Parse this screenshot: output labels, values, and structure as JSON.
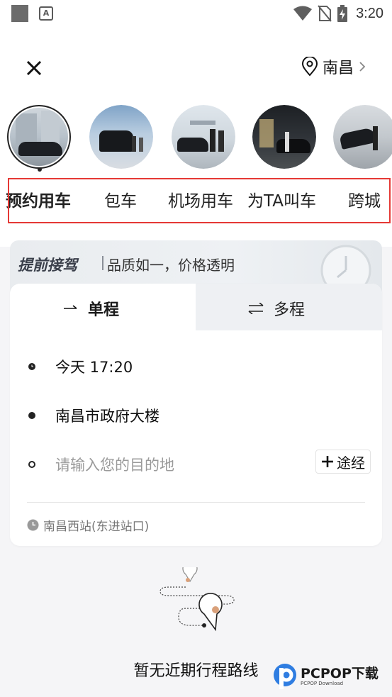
{
  "status_bar": {
    "time": "3:20",
    "icons": [
      "notification-square-icon",
      "a-app-icon",
      "wifi-icon",
      "no-sim-icon",
      "battery-charging-icon"
    ]
  },
  "header": {
    "close_icon": "close-icon",
    "city": "南昌",
    "city_icon": "location-pin-icon",
    "chevron_icon": "chevron-right-icon"
  },
  "services": [
    {
      "label": "预约用车",
      "active": true
    },
    {
      "label": "包车",
      "active": false
    },
    {
      "label": "机场用车",
      "active": false
    },
    {
      "label": "为TA叫车",
      "active": false
    },
    {
      "label": "跨城",
      "active": false
    }
  ],
  "promo": {
    "title": "提前接驾",
    "subtitle": "品质如一，价格透明"
  },
  "tabs": [
    {
      "label": "单程",
      "icon": "arrow-right-icon",
      "active": true
    },
    {
      "label": "多程",
      "icon": "swap-arrows-icon",
      "active": false
    }
  ],
  "trip": {
    "time": "今天 17:20",
    "pickup": "南昌市政府大楼",
    "destination_placeholder": "请输入您的目的地",
    "add_stop_label": "途经",
    "recent_place": "南昌西站(东进站口)"
  },
  "empty_state": {
    "text": "暂无近期行程路线"
  },
  "watermark": {
    "brand": "PCPOP下载",
    "sub": "PCPOP Download"
  },
  "colors": {
    "highlight_box": "#e53935",
    "background": "#f5f5f7",
    "accent_dot": "#d9a07a"
  }
}
